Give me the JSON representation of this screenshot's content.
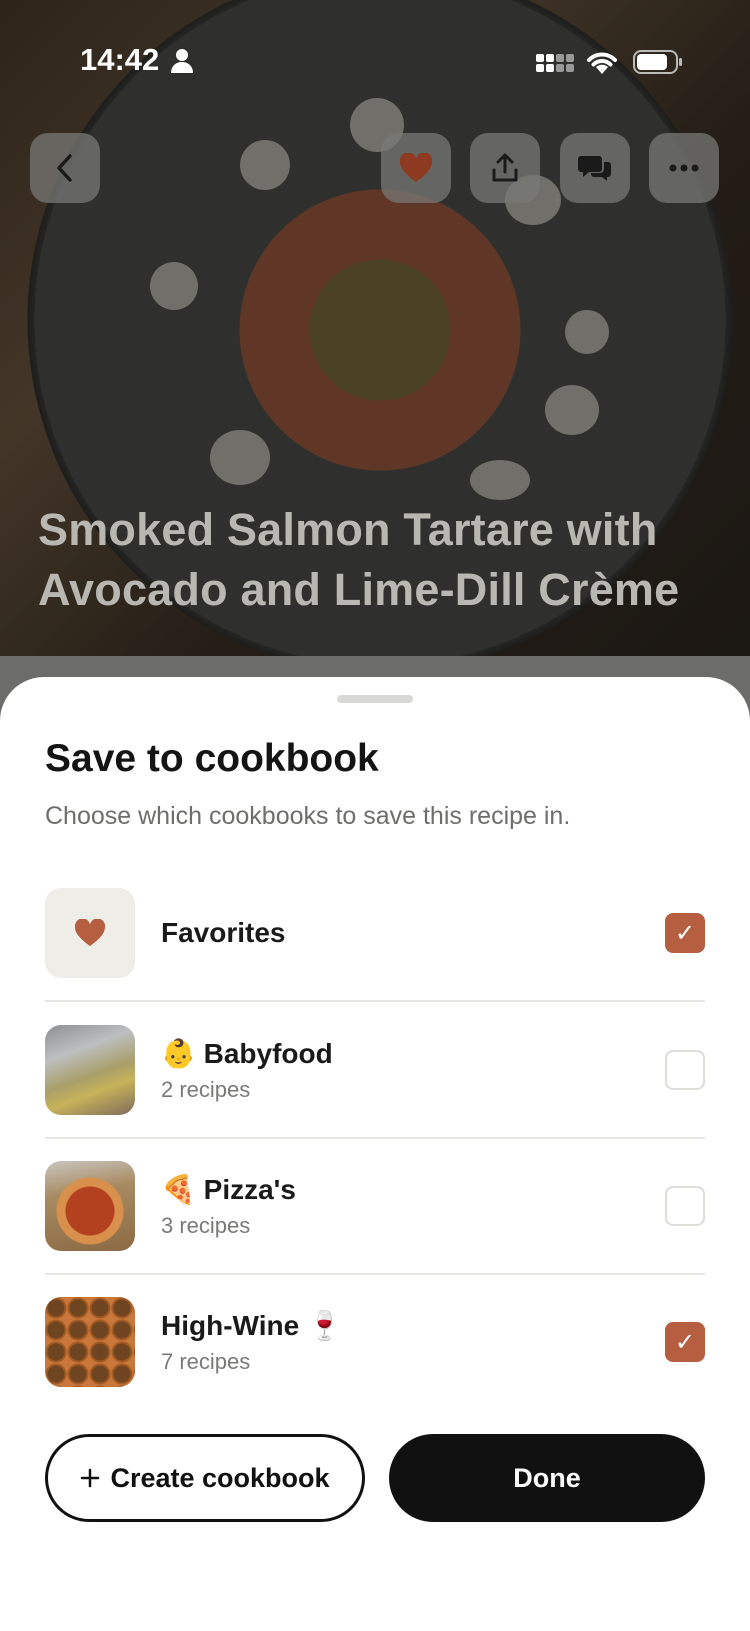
{
  "status_bar": {
    "time": "14:42",
    "icons": [
      "person-icon",
      "signal-icon",
      "wifi-icon",
      "battery-icon"
    ]
  },
  "top_actions": {
    "back": "chevron-left-icon",
    "favorite": "heart-icon",
    "share": "share-icon",
    "comments": "chat-bubbles-icon",
    "more": "ellipsis-icon"
  },
  "recipe": {
    "title": "Smoked Salmon Tartare with Avocado and Lime-Dill Crème"
  },
  "sheet": {
    "title": "Save to cookbook",
    "subtitle": "Choose which cookbooks to save this recipe in.",
    "cookbooks": [
      {
        "name": "Favorites",
        "count": "",
        "checked": true,
        "icon": "heart-icon"
      },
      {
        "name": "👶 Babyfood",
        "count": "2 recipes",
        "checked": false
      },
      {
        "name": "🍕 Pizza's",
        "count": "3 recipes",
        "checked": false
      },
      {
        "name": "High-Wine 🍷",
        "count": "7 recipes",
        "checked": true
      }
    ],
    "create_label": "Create cookbook",
    "create_icon": "plus-icon",
    "done_label": "Done"
  },
  "colors": {
    "accent": "#b65e40",
    "button_dark": "#111111",
    "sheet_bg": "#ffffff"
  }
}
